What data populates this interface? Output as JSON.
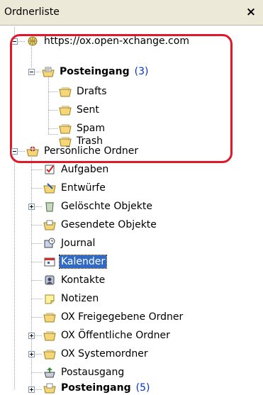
{
  "panel": {
    "title": "Ordnerliste",
    "close_label": "×"
  },
  "tree": {
    "account": "https://ox.open-xchange.com",
    "inbox": {
      "label": "Posteingang",
      "count": "(3)"
    },
    "mail_folders": [
      "Drafts",
      "Sent",
      "Spam",
      "Trash"
    ],
    "personal": {
      "label": "Persönliche Ordner"
    },
    "personal_folders": {
      "aufgaben": "Aufgaben",
      "entwuerfe": "Entwürfe",
      "geloeschte": "Gelöschte Objekte",
      "gesendete": "Gesendete Objekte",
      "journal": "Journal",
      "kalender": "Kalender",
      "kontakte": "Kontakte",
      "notizen": "Notizen",
      "ox_freigegebene": "OX Freigegebene Ordner",
      "ox_oeffentliche": "OX Öffentliche Ordner",
      "ox_system": "OX Systemordner",
      "postausgang": "Postausgang",
      "posteingang": {
        "label": "Posteingang",
        "count": "(5)"
      }
    }
  },
  "colors": {
    "highlight": "#e0192a",
    "selection": "#316ac5",
    "count": "#0033cc"
  }
}
